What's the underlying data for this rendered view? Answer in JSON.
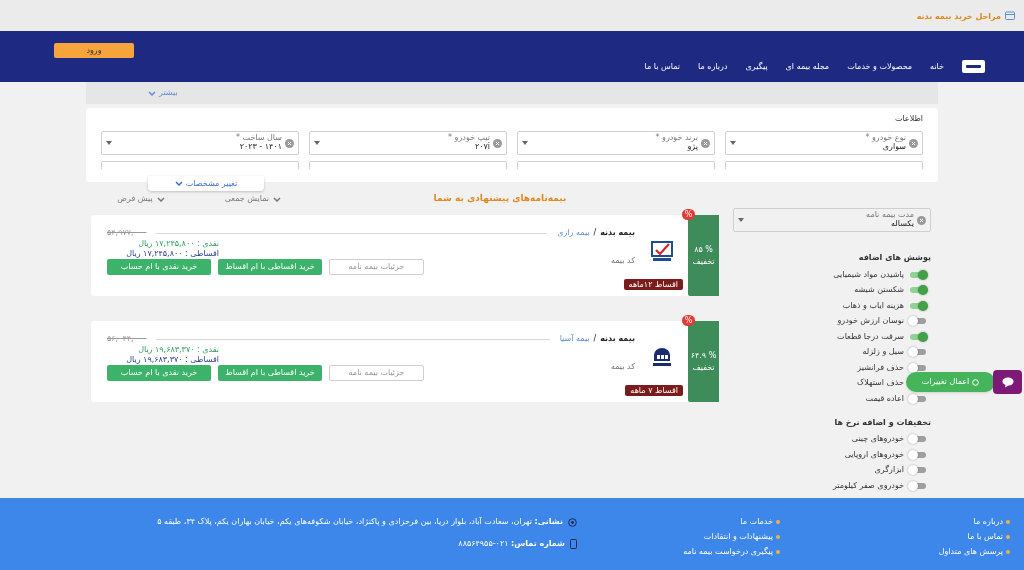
{
  "top_bar": {
    "title": "مراحل خرید بیمه بدنه"
  },
  "header": {
    "nav": [
      "خانه",
      "محصولات و خدمات",
      "مجله بیمه ای",
      "پیگیری",
      "درباره ما",
      "تماس با ما"
    ],
    "login_button": "ورود"
  },
  "summary": {
    "more_link": "بیشتر"
  },
  "vehicle_form": {
    "title": "اطلاعات",
    "fields": [
      {
        "label": "نوع خودرو *",
        "value": "سواری"
      },
      {
        "label": "برند خودرو *",
        "value": "پژو"
      },
      {
        "label": "تیپ خودرو *",
        "value": "۲۰۷i"
      },
      {
        "label": "سال ساخت *",
        "value": "۱۴۰۱ - ۲۰۲۳"
      }
    ],
    "change_tab": "تغییر مشخصات"
  },
  "offers": {
    "title": "بیمه‌نامه‌های پیشنهادی به شما",
    "sort_options": [
      "نمایش جمعی",
      "پیش فرض"
    ],
    "cards": [
      {
        "kind": "razi",
        "discount": "% ۸۵",
        "discount_label": "تخفیف",
        "badge": "%",
        "product": "بیمه بدنه",
        "separator": "/",
        "company": "بیمه رازی",
        "code_label": "کد بیمه",
        "installment_badge": "اقساط ۱۲ماهه",
        "old_price": "۵۴,۹۷۷,۰۰۰",
        "cash": "نقدی : ۱۷,۲۴۵,۸۰۰ ریال",
        "installment": "اقساطی : ۱۷,۲۴۵,۸۰۰ ریال",
        "buttons": [
          "جزئیات بیمه نامه",
          "خرید اقساطی با ام اقساط",
          "خرید نقدی با ام حساب"
        ]
      },
      {
        "kind": "asia",
        "discount": "% ۶۴.۹",
        "discount_label": "تخفیف",
        "badge": "%",
        "product": "بیمه بدنه",
        "separator": "/",
        "company": "بیمه آسیا",
        "code_label": "کد بیمه",
        "installment_badge": "اقساط ۷ ماهه",
        "old_price": "۵۶,۰۴۴,۰۰۰",
        "cash": "نقدی : ۱۹,۶۸۳,۳۷۰ ریال",
        "installment": "اقساطی : ۱۹,۶۸۳,۳۷۰ ریال",
        "buttons": [
          "جزئیات بیمه نامه",
          "خرید اقساطی با ام اقساط",
          "خرید نقدی با ام حساب"
        ]
      }
    ]
  },
  "sidebar": {
    "duration": {
      "label": "مدت بیمه نامه",
      "value": "یکساله"
    },
    "coverage_title": "پوشش های اضافه",
    "coverages": [
      {
        "label": "پاشیدن مواد شیمیایی",
        "on": true
      },
      {
        "label": "شکستن شیشه",
        "on": true
      },
      {
        "label": "هزینه ایاب و ذهاب",
        "on": true
      },
      {
        "label": "نوسان ارزش خودرو",
        "on": false
      },
      {
        "label": "سرقت درجا قطعات",
        "on": true
      },
      {
        "label": "سیل و زلزله",
        "on": false
      },
      {
        "label": "حذف فرانشیز",
        "on": false
      },
      {
        "label": "حذف استهلاک"
      },
      {
        "label": "اعاده قیمت",
        "on": false
      }
    ],
    "discount_title": "تخفیفات و اضافه نرخ ها",
    "discounts": [
      {
        "label": "خودروهای چینی",
        "on": false
      },
      {
        "label": "خودروهای اروپایی",
        "on": false
      },
      {
        "label": "ابزارگری",
        "on": false
      },
      {
        "label": "خودروی صفر کیلومتر",
        "on": false
      }
    ]
  },
  "apply_button": "اعمال تغییرات",
  "footer": {
    "links": [
      "درباره ما",
      "تماس با ما",
      "پرسش های متداول"
    ],
    "services": [
      "خدمات ما",
      "پیشنهادات و انتقادات",
      "پیگیری درخواست بیمه نامه"
    ],
    "address_label": "نشانی:",
    "address": "تهران، سعادت آباد، بلوار دریا، بین فرحزادی و پاکنژاد، خیابان شکوفه‌های یکم، خیابان بهاران یکم، پلاک ۳۴، طبقه ۵",
    "phone_label": "شماره تماس:",
    "phone": "۰۲۱-۸۸۵۶۴۹۵۵"
  }
}
